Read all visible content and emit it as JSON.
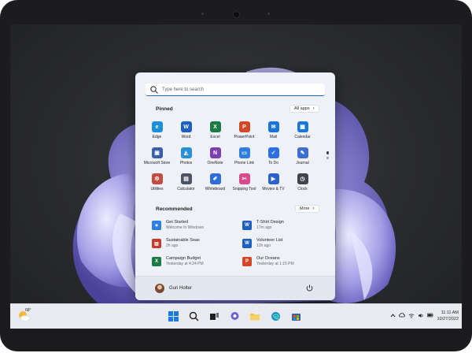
{
  "search": {
    "placeholder": "Type here to search"
  },
  "pinned": {
    "title": "Pinned",
    "all_apps_label": "All apps",
    "apps": [
      {
        "label": "Edge",
        "icon": "edge-icon",
        "color": "#1b8fd8",
        "glyph": "e"
      },
      {
        "label": "Word",
        "icon": "word-icon",
        "color": "#1f5fbf",
        "glyph": "W"
      },
      {
        "label": "Excel",
        "icon": "excel-icon",
        "color": "#1d7a45",
        "glyph": "X"
      },
      {
        "label": "PowerPoint",
        "icon": "powerpoint-icon",
        "color": "#d24726",
        "glyph": "P"
      },
      {
        "label": "Mail",
        "icon": "mail-icon",
        "color": "#1a73d9",
        "glyph": "✉"
      },
      {
        "label": "Calendar",
        "icon": "calendar-icon",
        "color": "#1978d4",
        "glyph": "▦"
      },
      {
        "label": "Microsoft Store",
        "icon": "store-icon",
        "color": "#3a5fa8",
        "glyph": "▣"
      },
      {
        "label": "Photos",
        "icon": "photos-icon",
        "color": "#2b8fd6",
        "glyph": "◭"
      },
      {
        "label": "OneNote",
        "icon": "onenote-icon",
        "color": "#7b3fb0",
        "glyph": "N"
      },
      {
        "label": "Phone Link",
        "icon": "phone-link-icon",
        "color": "#2f7fe0",
        "glyph": "▭"
      },
      {
        "label": "To Do",
        "icon": "todo-icon",
        "color": "#2f6fe6",
        "glyph": "✓"
      },
      {
        "label": "Journal",
        "icon": "journal-icon",
        "color": "#3c6fcf",
        "glyph": "✎"
      },
      {
        "label": "Utilities",
        "icon": "utilities-icon",
        "color": "#c24c3d",
        "glyph": "⚙"
      },
      {
        "label": "Calculator",
        "icon": "calculator-icon",
        "color": "#4b5563",
        "glyph": "▤"
      },
      {
        "label": "Whiteboard",
        "icon": "whiteboard-icon",
        "color": "#2e6ed8",
        "glyph": "✐"
      },
      {
        "label": "Snipping Tool",
        "icon": "snipping-tool-icon",
        "color": "#d94a8c",
        "glyph": "✂"
      },
      {
        "label": "Movies & TV",
        "icon": "movies-tv-icon",
        "color": "#2a62c9",
        "glyph": "▶"
      },
      {
        "label": "Clock",
        "icon": "clock-icon",
        "color": "#3f4450",
        "glyph": "◷"
      }
    ]
  },
  "recommended": {
    "title": "Recommended",
    "more_label": "More",
    "items": [
      {
        "title": "Get Started",
        "subtitle": "Welcome to Windows",
        "icon": "get-started-icon",
        "color": "#2f7fe0",
        "glyph": "✶"
      },
      {
        "title": "T-Shirt Design",
        "subtitle": "17m ago",
        "icon": "word-doc-icon",
        "color": "#1f5fbf",
        "glyph": "W"
      },
      {
        "title": "Sustainable Seas",
        "subtitle": "2h ago",
        "icon": "pdf-icon",
        "color": "#c8382b",
        "glyph": "▥"
      },
      {
        "title": "Volunteer List",
        "subtitle": "12h ago",
        "icon": "word-doc-icon",
        "color": "#1f5fbf",
        "glyph": "W"
      },
      {
        "title": "Campaign Budget",
        "subtitle": "Yesterday at 4:24 PM",
        "icon": "excel-doc-icon",
        "color": "#1d7a45",
        "glyph": "X"
      },
      {
        "title": "Our Oceans",
        "subtitle": "Yesterday at 1:15 PM",
        "icon": "powerpoint-doc-icon",
        "color": "#d24726",
        "glyph": "P"
      }
    ]
  },
  "user": {
    "name": "Guri Holter"
  },
  "taskbar": {
    "weather_temp": "68°",
    "time": "11:11 AM",
    "date": "10/27/2022"
  },
  "colors": {
    "accent": "#2266cc",
    "taskbar_bg": "#e9ebf0",
    "start_bg": "#eef1f7"
  }
}
